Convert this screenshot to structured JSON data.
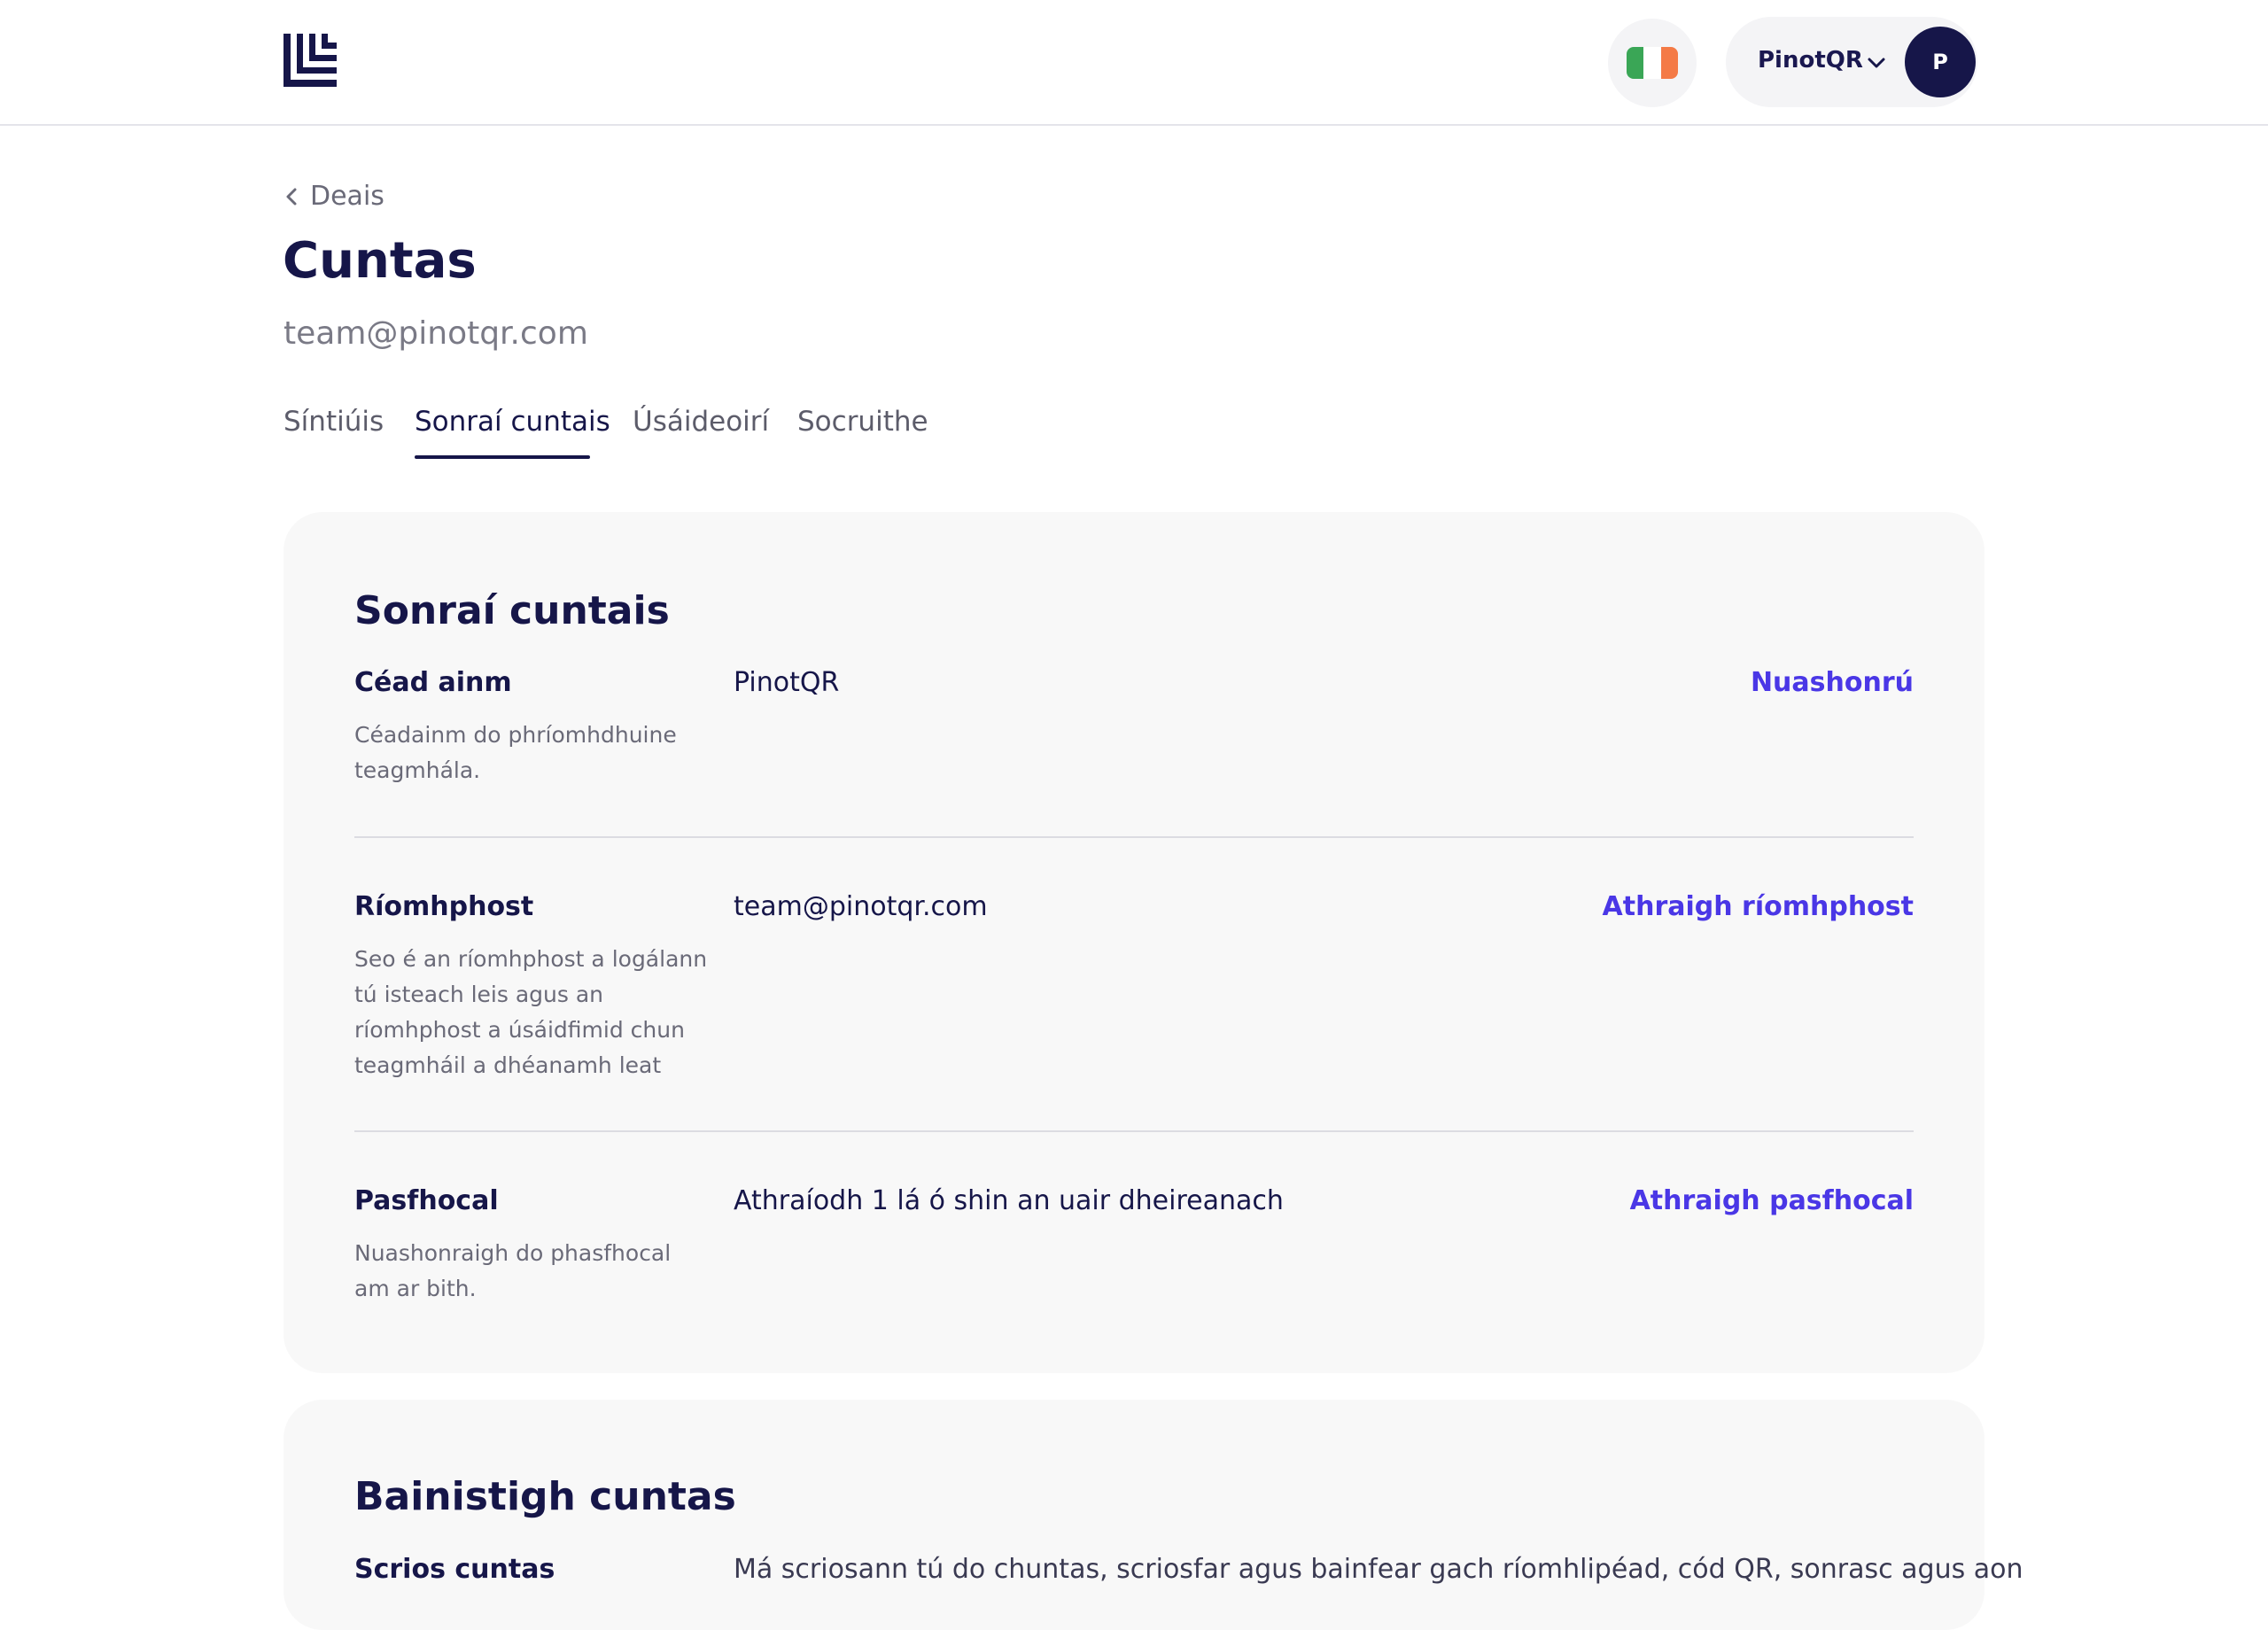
{
  "header": {
    "logo_icon": "brand-logo-icon",
    "language_flag": {
      "icon": "ireland-flag-icon",
      "colors": [
        "#3aa656",
        "#ffffff",
        "#f47a46"
      ]
    },
    "account": {
      "name": "PinotQR",
      "avatar_initial": "P",
      "chevron_icon": "chevron-down-icon"
    }
  },
  "page": {
    "back_label": "Deais",
    "title": "Cuntas",
    "email": "team@pinotqr.com"
  },
  "tabs": [
    {
      "label": "Síntiúis",
      "active": false
    },
    {
      "label": "Sonraí cuntais",
      "active": true
    },
    {
      "label": "Úsáideoirí",
      "active": false
    },
    {
      "label": "Socruithe",
      "active": false
    }
  ],
  "account_details": {
    "title": "Sonraí cuntais",
    "rows": [
      {
        "label": "Céad ainm",
        "description": "Céadainm do phríomhdhuine teagmhála.",
        "value": "PinotQR",
        "action": "Nuashonrú"
      },
      {
        "label": "Ríomhphost",
        "description": "Seo é an ríomhphost a logálann tú isteach leis agus an ríomhphost a úsáidfimid chun teagmháil a dhéanamh leat",
        "value": "team@pinotqr.com",
        "action": "Athraigh ríomhphost"
      },
      {
        "label": "Pasfhocal",
        "description": "Nuashonraigh do phasfhocal am ar bith.",
        "value": "Athraíodh 1 lá ó shin an uair dheireanach",
        "action": "Athraigh pasfhocal"
      }
    ]
  },
  "manage_account": {
    "title": "Bainistigh cuntas",
    "delete_label": "Scrios cuntas",
    "delete_text": "Má scriosann tú do chuntas, scriosfar agus bainfear gach ríomhlipéad, cód QR, sonrasc agus aon"
  },
  "colors": {
    "primary": "#161649",
    "link": "#4a37e6",
    "card_bg": "#f8f8f8"
  }
}
